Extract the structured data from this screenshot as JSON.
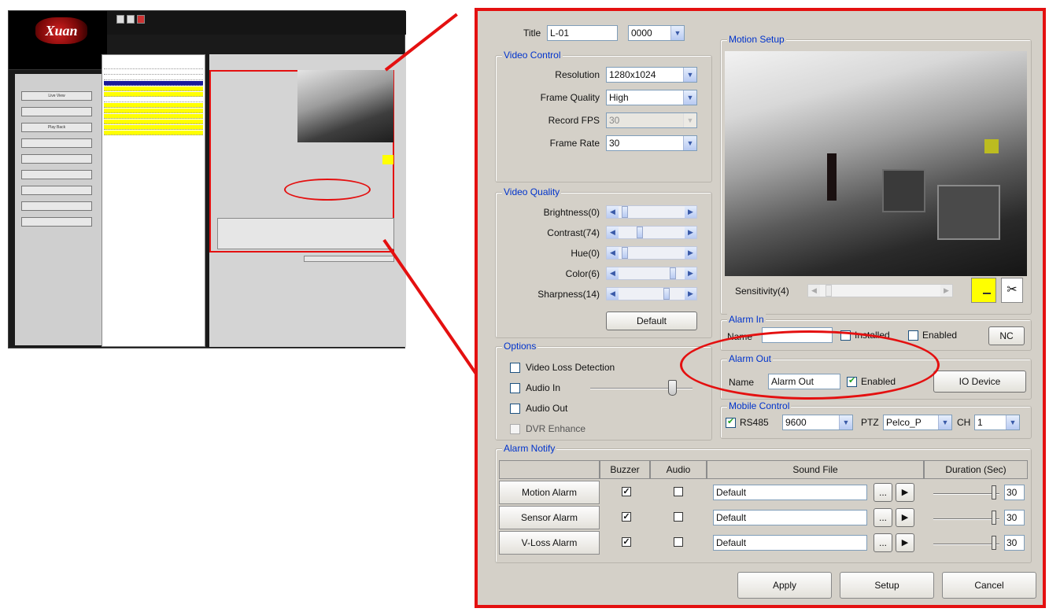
{
  "app": {
    "logo_text": "Xuan"
  },
  "overview": {
    "nav_items": [
      "Live View",
      "",
      "Play Back",
      "",
      "",
      "",
      "",
      "",
      ""
    ],
    "row_colors": [
      "#ffffff",
      "#ffffff",
      "#ffffff",
      "#1a1a9a",
      "#ffff00",
      "#ffff00",
      "#ffffff",
      "#ffff00",
      "#ffff00",
      "#ffff00",
      "#ffff00",
      "#ffff00",
      "#ffff00"
    ]
  },
  "dialog": {
    "title_label": "Title",
    "title_value": "L-01",
    "title_select": "0000",
    "video_control": {
      "legend": "Video Control",
      "rows": [
        {
          "label": "Resolution",
          "value": "1280x1024",
          "disabled": false
        },
        {
          "label": "Frame Quality",
          "value": "High",
          "disabled": false
        },
        {
          "label": "Record FPS",
          "value": "30",
          "disabled": true
        },
        {
          "label": "Frame Rate",
          "value": "30",
          "disabled": false
        }
      ]
    },
    "video_quality": {
      "legend": "Video Quality",
      "sliders": [
        {
          "label": "Brightness(0)",
          "value": 0.05
        },
        {
          "label": "Contrast(74)",
          "value": 0.3
        },
        {
          "label": "Hue(0)",
          "value": 0.05
        },
        {
          "label": "Color(6)",
          "value": 0.85
        },
        {
          "label": "Sharpness(14)",
          "value": 0.75
        }
      ],
      "default_label": "Default"
    },
    "options": {
      "legend": "Options",
      "video_loss": "Video Loss Detection",
      "audio_in": "Audio In",
      "audio_out": "Audio Out",
      "dvr_enhance": "DVR Enhance",
      "audio_volume": 0.8
    },
    "motion": {
      "legend": "Motion Setup",
      "sensitivity_label": "Sensitivity(4)",
      "sensitivity": 0.05
    },
    "alarm_in": {
      "legend": "Alarm In",
      "name_label": "Name",
      "name_value": "",
      "installed_label": "Installed",
      "enabled_label": "Enabled",
      "nc_label": "NC"
    },
    "alarm_out": {
      "legend": "Alarm Out",
      "name_label": "Name",
      "name_value": "Alarm Out",
      "enabled_label": "Enabled",
      "io_button": "IO Device"
    },
    "mobile": {
      "legend": "Mobile Control",
      "rs485_label": "RS485",
      "baud": "9600",
      "ptz_label": "PTZ",
      "ptz_value": "Pelco_P",
      "ch_label": "CH",
      "ch_value": "1"
    },
    "alarm_notify": {
      "legend": "Alarm Notify",
      "headers": [
        "",
        "Buzzer",
        "Audio",
        "Sound File",
        "Duration (Sec)"
      ],
      "rows": [
        {
          "name": "Motion Alarm",
          "buzzer": true,
          "audio": false,
          "file": "Default",
          "duration": "30",
          "level": 0.92
        },
        {
          "name": "Sensor Alarm",
          "buzzer": true,
          "audio": false,
          "file": "Default",
          "duration": "30",
          "level": 0.92
        },
        {
          "name": "V-Loss Alarm",
          "buzzer": true,
          "audio": false,
          "file": "Default",
          "duration": "30",
          "level": 0.92
        }
      ],
      "browse_label": "...",
      "play_icon": "▶"
    },
    "buttons": {
      "apply": "Apply",
      "setup": "Setup",
      "cancel": "Cancel"
    }
  }
}
